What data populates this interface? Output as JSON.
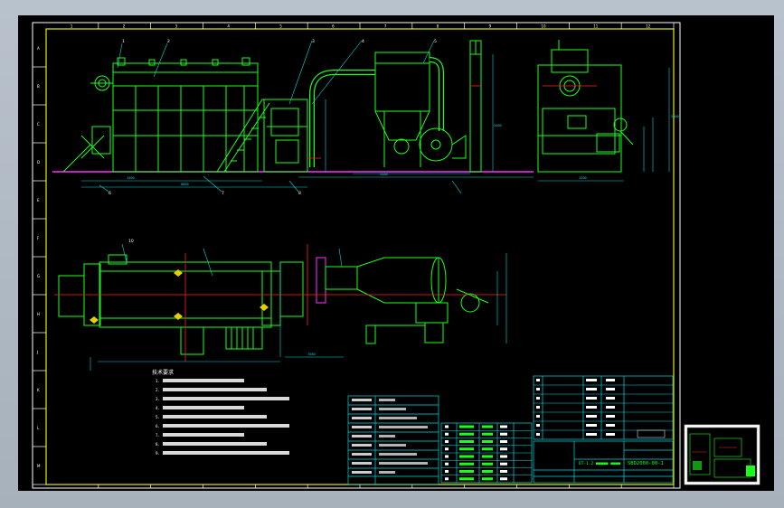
{
  "drawing": {
    "title_block": {
      "drawing_number": "SBD2000-00-1",
      "subtitle": "DT-1.2 ■■■■■ ■■■■"
    },
    "top_zone_numbers": [
      "1",
      "2",
      "3",
      "4",
      "5",
      "6",
      "7",
      "8",
      "9",
      "10",
      "11",
      "12"
    ],
    "side_zone_letters": [
      "A",
      "B",
      "C",
      "D",
      "E",
      "F",
      "G",
      "H",
      "J",
      "K",
      "L",
      "M"
    ],
    "balloons_front": [
      "1",
      "2",
      "3",
      "4",
      "5",
      "6",
      "7",
      "8"
    ],
    "balloon_plan": "10",
    "dimensions": [
      "1500",
      "8800",
      "5400",
      "7580",
      "1200",
      "3400",
      "3000"
    ],
    "notes_heading": "技术要求",
    "notes_lines": [
      "1.",
      "2.",
      "3.",
      "4.",
      "5.",
      "6.",
      "7.",
      "8.",
      "9."
    ],
    "colors": {
      "background_outer": "#b0bac4",
      "sheet": "#000000",
      "frame": "#ffffff",
      "border_inner": "#e8e800",
      "geometry_green": "#1aff1a",
      "dimension_cyan": "#00d8e0",
      "centerline_red": "#ff2020",
      "magenta": "#ff30ff",
      "blue": "#3060ff"
    }
  }
}
